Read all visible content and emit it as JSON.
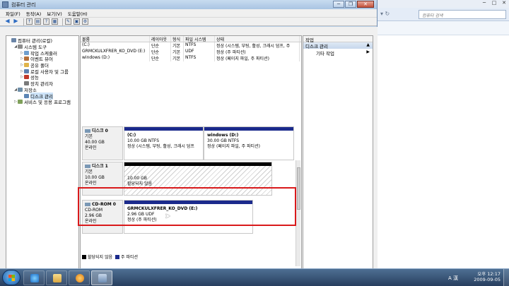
{
  "window": {
    "title": "컴퓨터 관리"
  },
  "menu": [
    "파일(F)",
    "동작(A)",
    "보기(V)",
    "도움말(H)"
  ],
  "background_window": {
    "search_placeholder": "컴퓨터 검색"
  },
  "tree": [
    {
      "label": "컴퓨터 관리(로컬)",
      "indent": 0,
      "expander": "",
      "icon": "computer-icon"
    },
    {
      "label": "시스템 도구",
      "indent": 1,
      "expander": "◢",
      "icon": "tools-icon"
    },
    {
      "label": "작업 스케줄러",
      "indent": 2,
      "expander": "▷",
      "icon": "clock-icon"
    },
    {
      "label": "이벤트 뷰어",
      "indent": 2,
      "expander": "▷",
      "icon": "event-viewer-icon"
    },
    {
      "label": "공유 폴더",
      "indent": 2,
      "expander": "▷",
      "icon": "shared-folder-icon"
    },
    {
      "label": "로컬 사용자 및 그룹",
      "indent": 2,
      "expander": "▷",
      "icon": "users-icon"
    },
    {
      "label": "성능",
      "indent": 2,
      "expander": "▷",
      "icon": "performance-icon"
    },
    {
      "label": "장치 관리자",
      "indent": 2,
      "expander": "",
      "icon": "device-manager-icon"
    },
    {
      "label": "저장소",
      "indent": 1,
      "expander": "◢",
      "icon": "storage-icon"
    },
    {
      "label": "디스크 관리",
      "indent": 2,
      "expander": "",
      "icon": "disk-management-icon",
      "selected": true
    },
    {
      "label": "서비스 및 응용 프로그램",
      "indent": 1,
      "expander": "▷",
      "icon": "services-icon"
    }
  ],
  "volume_table": {
    "headers": [
      "볼륨",
      "레이아웃",
      "형식",
      "파일 시스템",
      "상태"
    ],
    "rows": [
      [
        "(C:)",
        "단순",
        "기본",
        "NTFS",
        "정상 (시스템, 부팅, 활성, 크래시 덤프, 주"
      ],
      [
        "GRMCKULXFRER_KO_DVD (E:)",
        "단순",
        "기본",
        "UDF",
        "정상 (주 파티션)"
      ],
      [
        "windows (D:)",
        "단순",
        "기본",
        "NTFS",
        "정상 (페이지 파일, 주 파티션)"
      ]
    ]
  },
  "disks": [
    {
      "name": "디스크 0",
      "type": "기본",
      "size": "40.00 GB",
      "status": "온라인",
      "partitions": [
        {
          "name": "(C:)",
          "size": "10.00 GB NTFS",
          "status": "정상 (시스템, 부팅, 활성, 크래시 덤프",
          "bar": "blue"
        },
        {
          "name": "windows  (D:)",
          "size": "30.00 GB NTFS",
          "status": "정상 (페이지 파일, 주 파티션)",
          "bar": "blue"
        }
      ]
    },
    {
      "name": "디스크 1",
      "type": "기본",
      "size": "10.00 GB",
      "status": "온라인",
      "partitions": [
        {
          "name": "",
          "size": "10.00 GB",
          "status": "할당되지 않음",
          "bar": "black"
        }
      ]
    },
    {
      "name": "CD-ROM 0",
      "type": "CD-ROM",
      "size": "2.96 GB",
      "status": "온라인",
      "partitions": [
        {
          "name": "GRMCKULXFRER_KO_DVD  (E:)",
          "size": "2.96 GB UDF",
          "status": "정상 (주 파티션)",
          "bar": "blue"
        }
      ]
    }
  ],
  "legend": [
    {
      "label": "할당되지 않음",
      "color": "#000000"
    },
    {
      "label": "주 파티션",
      "color": "#1b2a8c"
    }
  ],
  "actions": {
    "header": "작업",
    "section": "디스크 관리",
    "item": "기타 작업"
  },
  "tray": {
    "ime": "A 漢",
    "time": "오후 12:17",
    "date": "2009-09-05"
  },
  "colors": {
    "highlight": "#d9191b",
    "primary_partition": "#1b2a8c"
  }
}
